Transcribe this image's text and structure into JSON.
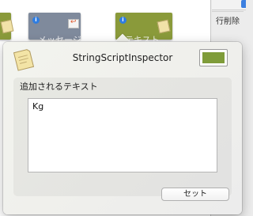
{
  "background": {
    "side_button_label": "行削除",
    "card_b_caption": "メッセージ",
    "card_c_caption": "テキスト"
  },
  "popover": {
    "title": "StringScriptInspector",
    "swatch_color": "#7f9c3a",
    "text_label": "追加されるテキスト",
    "text_value": "Kg",
    "set_button_label": "セット"
  }
}
